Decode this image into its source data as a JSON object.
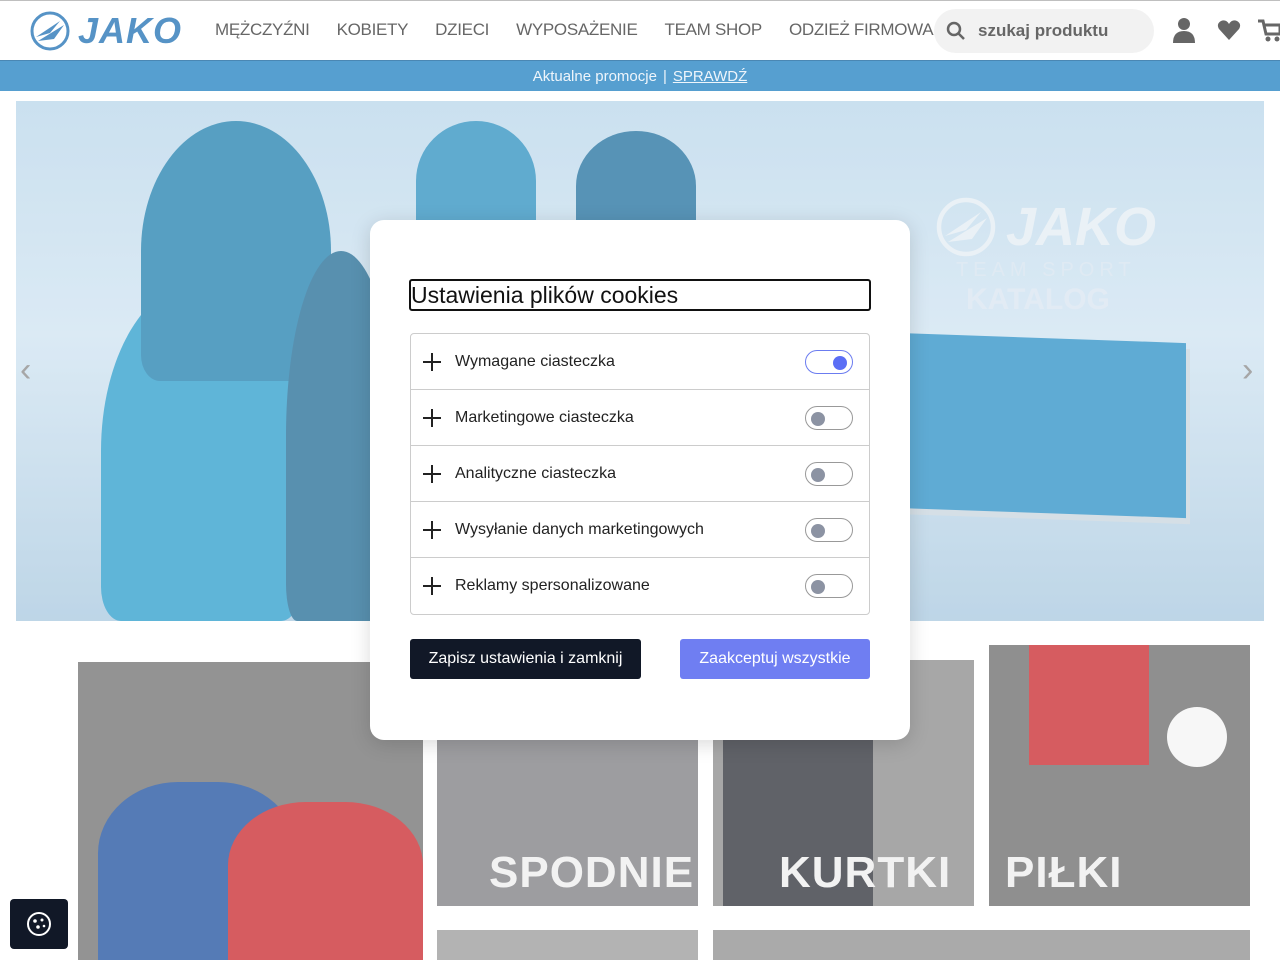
{
  "header": {
    "logo_text": "JAKO",
    "nav": [
      "MĘŻCZYŹNI",
      "KOBIETY",
      "DZIECI",
      "WYPOSAŻENIE",
      "TEAM SHOP",
      "ODZIEŻ FIRMOWA",
      "..."
    ],
    "search_placeholder": "szukaj produktu"
  },
  "promo": {
    "text": "Aktualne promocje",
    "separator": "|",
    "link": "SPRAWDŹ"
  },
  "hero": {
    "logo_text": "JAKO",
    "subtitle": "TEAM SPORT",
    "title": "KATALOG",
    "prev_arrow": "‹",
    "next_arrow": "›"
  },
  "tiles": {
    "spodnie": "SPODNIE",
    "kurtki": "KURTKI",
    "pilki": "PIŁKI"
  },
  "cookie_modal": {
    "title": "Ustawienia plików cookies",
    "categories": [
      {
        "label": "Wymagane ciasteczka",
        "enabled": true
      },
      {
        "label": "Marketingowe ciasteczka",
        "enabled": false
      },
      {
        "label": "Analityczne ciasteczka",
        "enabled": false
      },
      {
        "label": "Wysyłanie danych marketingowych",
        "enabled": false
      },
      {
        "label": "Reklamy spersonalizowane",
        "enabled": false
      }
    ],
    "save_button": "Zapisz ustawienia i zamknij",
    "accept_button": "Zaakceptuj wszystkie"
  },
  "colors": {
    "brand_blue": "#1e6fb3",
    "promo_bar": "#1e7fc0",
    "toggle_on": "#5b6ef5",
    "save_button": "#111827",
    "accept_button": "#6f7ef2"
  },
  "icons": [
    "search-icon",
    "account-icon",
    "heart-icon",
    "cart-icon",
    "plus-icon",
    "cookie-icon"
  ]
}
